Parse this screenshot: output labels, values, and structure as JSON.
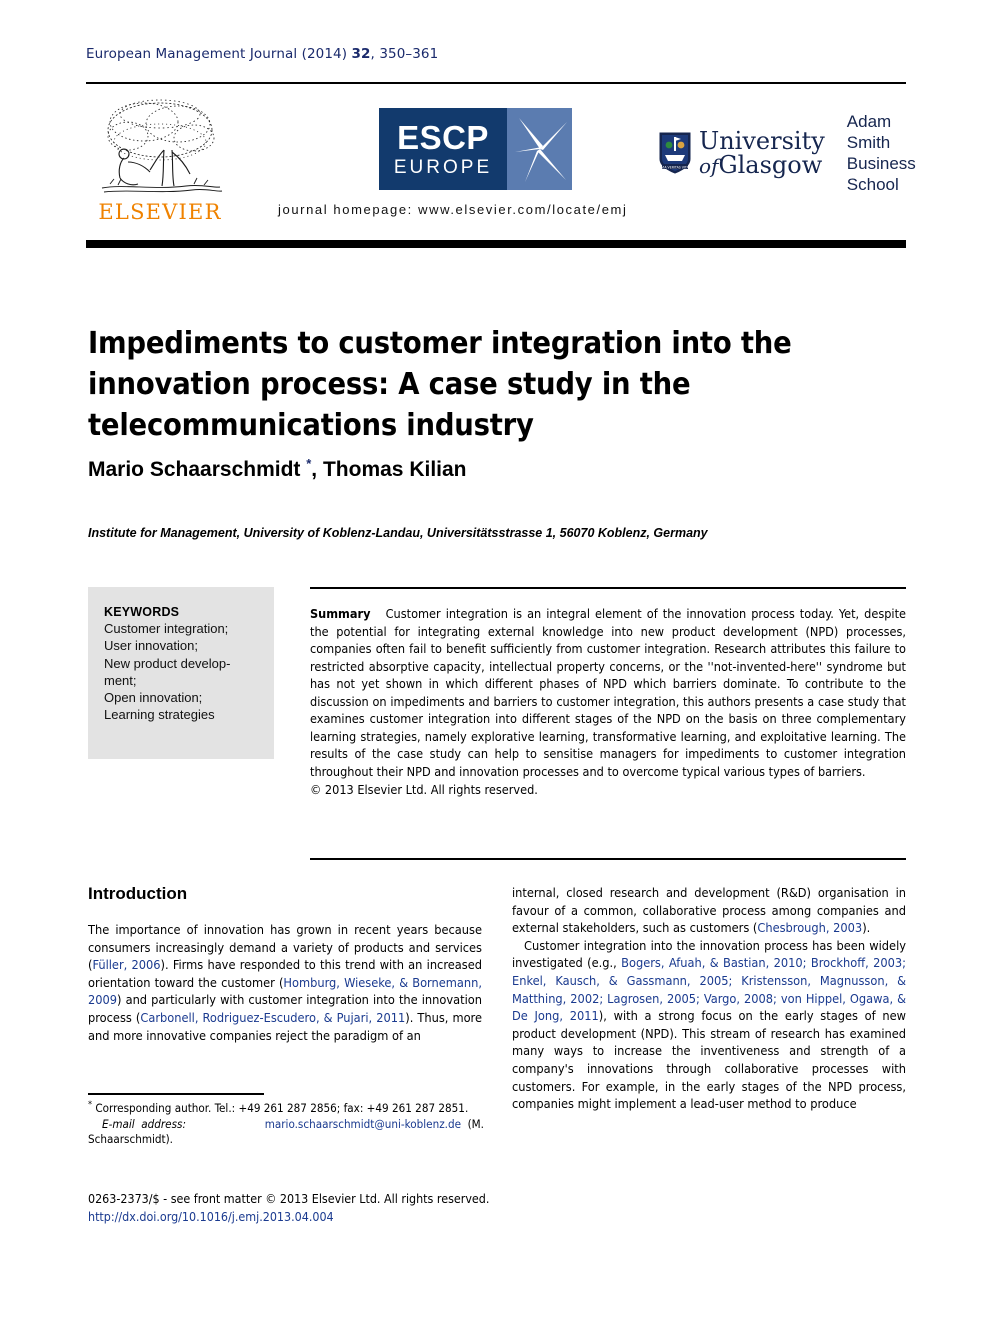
{
  "header": {
    "journal_name": "European Management Journal",
    "year": "(2014)",
    "volume": "32",
    "pages": ", 350–361",
    "homepage": "journal homepage: www.elsevier.com/locate/emj"
  },
  "logos": {
    "elsevier_wordmark": "ELSEVIER",
    "escp_line1": "ESCP",
    "escp_line2": "EUROPE",
    "glasgow_line1": "University",
    "glasgow_line2_italic": "of",
    "glasgow_line2": "Glasgow",
    "school_line1": "Adam Smith",
    "school_line2": "Business School"
  },
  "article": {
    "title": "Impediments to customer integration into the innovation process: A case study in the telecommunications industry",
    "authors": "Mario Schaarschmidt ",
    "author_star": "*",
    "authors_rest": ", Thomas Kilian",
    "affiliation": "Institute for Management, University of Koblenz-Landau, Universitätsstrasse 1, 56070 Koblenz, Germany"
  },
  "keywords": {
    "title": "KEYWORDS",
    "items": "Customer integration; User innovation; New product develop- ment; Open innovation; Learning strategies"
  },
  "summary": {
    "label": "Summary",
    "text": "Customer integration is an integral element of the innovation process today. Yet, despite the potential for integrating external knowledge into new product development (NPD) processes, companies often fail to benefit sufficiently from customer integration. Research attributes this failure to restricted absorptive capacity, intellectual property concerns, or the ''not-invented-here'' syndrome but has not yet shown in which different phases of NPD which barriers dominate. To contribute to the discussion on impediments and barriers to customer integration, this authors presents a case study that examines customer integration into different stages of the NPD on the basis on three complementary learning strategies, namely explorative learning, transformative learning, and exploitative learning. The results of the case study can help to sensitise managers for impediments to customer integration throughout their NPD and innovation processes and to overcome typical various types of barriers.",
    "copyright": "© 2013 Elsevier Ltd. All rights reserved."
  },
  "body": {
    "section_heading": "Introduction",
    "left_paragraph_1_a": "The importance of innovation has grown in recent years because consumers increasingly demand a variety of products and services (",
    "left_ref_1": "Füller, 2006",
    "left_paragraph_1_b": "). Firms have responded to this trend with an increased orientation toward the customer (",
    "left_ref_2": "Homburg, Wieseke, & Bornemann, 2009",
    "left_paragraph_1_c": ") and particularly with customer integration into the innovation process (",
    "left_ref_3": "Carbonell, Rodriguez-Escudero, & Pujari, 2011",
    "left_paragraph_1_d": "). Thus, more and more innovative companies reject the paradigm of an",
    "right_paragraph_1_a": "internal, closed research and development (R&D) organisation in favour of a common, collaborative process among companies and external stakeholders, such as customers (",
    "right_ref_1": "Chesbrough, 2003",
    "right_paragraph_1_b": ").",
    "right_paragraph_2_a": "Customer integration into the innovation process has been widely investigated (e.g., ",
    "right_ref_2": "Bogers, Afuah, & Bastian, 2010; Brockhoff, 2003; Enkel, Kausch, & Gassmann, 2005; Kristensson, Magnusson, & Matthing, 2002; Lagrosen, 2005; Vargo, 2008; von Hippel, Ogawa, & De Jong, 2011",
    "right_paragraph_2_b": "), with a strong focus on the early stages of new product development (NPD). This stream of research has examined many ways to increase the inventiveness and strength of a company's innovations through collaborative processes with customers. For example, in the early stages of the NPD process, companies might implement a lead-user method to produce"
  },
  "footnotes": {
    "star": "*",
    "corresponding": " Corresponding author. Tel.: +49 261 287 2856; fax: +49 261 287 2851.",
    "email_label": "E-mail address:",
    "email": "mario.schaarschmidt@uni-koblenz.de",
    "email_owner": "(M. Schaarschmidt)."
  },
  "footer": {
    "issn_line": "0263-2373/$ - see front matter © 2013 Elsevier Ltd. All rights reserved.",
    "doi": "http://dx.doi.org/10.1016/j.emj.2013.04.004"
  },
  "colors": {
    "journal_blue": "#1a2a6c",
    "reference_blue": "#1a3a8f",
    "elsevier_orange": "#ef8200",
    "escp_navy": "#123a6d",
    "escp_blue": "#5b7cb0",
    "glasgow_navy": "#16264f",
    "keywords_bg": "#e3e3e3"
  }
}
